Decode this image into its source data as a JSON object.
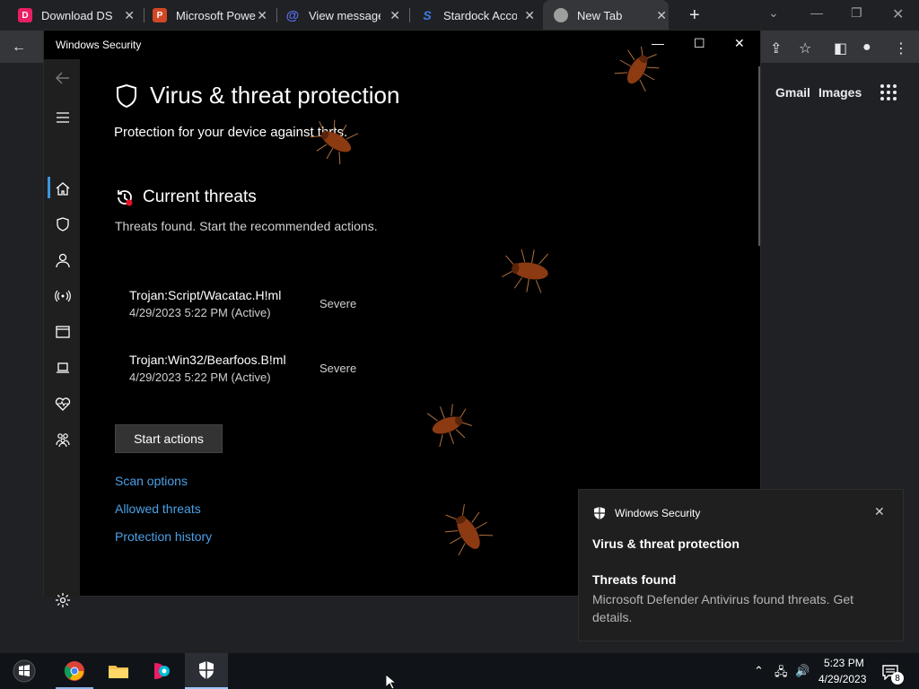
{
  "browser": {
    "tabs": [
      {
        "title": "Download DS",
        "color": "#e91e63"
      },
      {
        "title": "Microsoft Powe",
        "color": "#d24726"
      },
      {
        "title": "View message -",
        "color": "#5a6cf0"
      },
      {
        "title": "Stardock Accou",
        "color": "#3c7ee8"
      },
      {
        "title": "New Tab",
        "color": "#9e9e9e"
      }
    ],
    "newtab_symbol": "+",
    "links": {
      "gmail": "Gmail",
      "images": "Images"
    }
  },
  "window": {
    "title": "Windows Security",
    "controls": {
      "minimize": "—",
      "maximize": "☐",
      "close": "✕"
    }
  },
  "main": {
    "heading": "Virus & threat protection",
    "subheading": "Protection for your device against thr",
    "subheading_end": "ts.",
    "current_threats": {
      "title": "Current threats",
      "subtitle": "Threats found. Start the recommended actions.",
      "threats": [
        {
          "name": "Trojan:Script/Wacatac.H!ml",
          "date": "4/29/2023 5:22 PM (Active)",
          "severity": "Severe"
        },
        {
          "name": "Trojan:Win32/Bearfoos.B!ml",
          "date": "4/29/2023 5:22 PM (Active)",
          "severity": "Severe"
        }
      ],
      "action_button": "Start actions"
    },
    "links": [
      "Scan options",
      "Allowed threats",
      "Protection history"
    ]
  },
  "toast": {
    "app": "Windows Security",
    "title": "Virus & threat protection",
    "heading": "Threats found",
    "body": "Microsoft Defender Antivirus found threats. Get details."
  },
  "taskbar": {
    "time": "5:23 PM",
    "date": "4/29/2023",
    "notification_count": "8"
  }
}
